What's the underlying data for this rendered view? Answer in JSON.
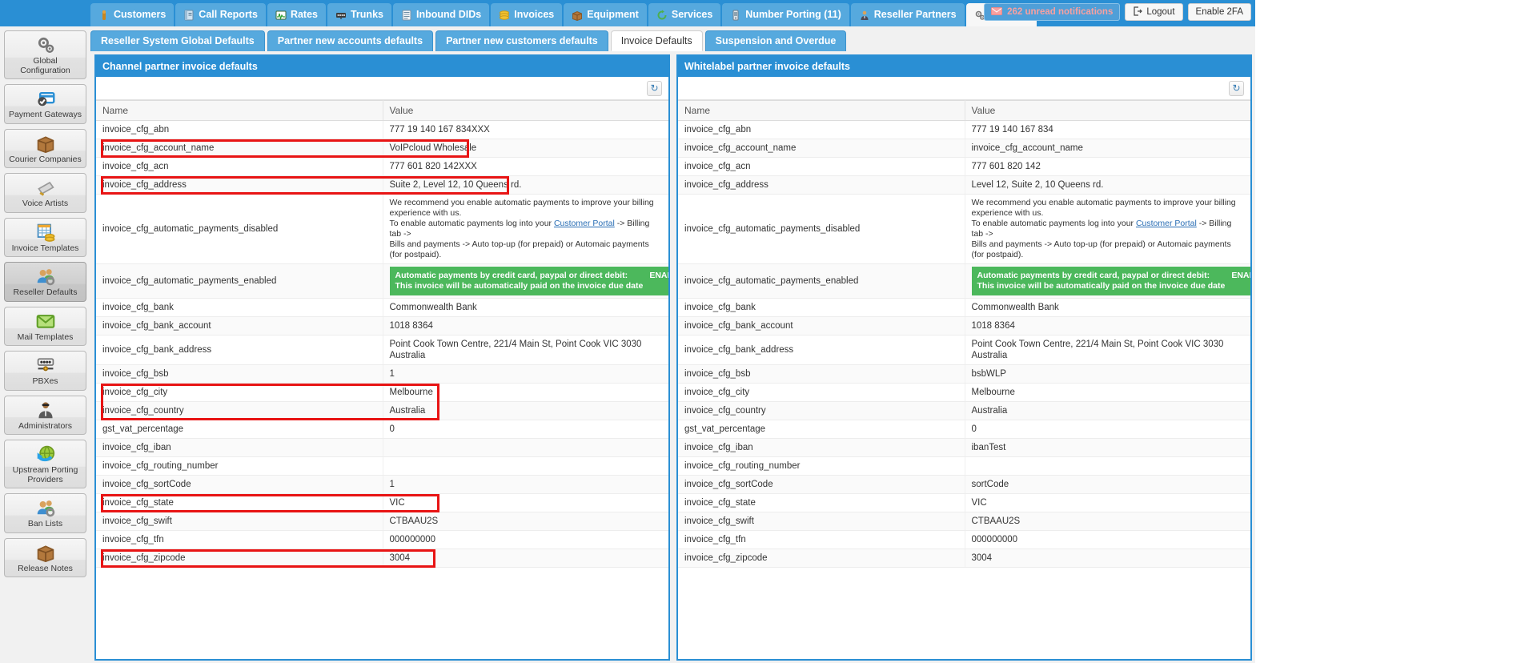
{
  "topnav": {
    "tabs": [
      {
        "label": "Customers",
        "icon": "person-icon"
      },
      {
        "label": "Call Reports",
        "icon": "report-icon"
      },
      {
        "label": "Rates",
        "icon": "chart-icon"
      },
      {
        "label": "Trunks",
        "icon": "trunk-icon"
      },
      {
        "label": "Inbound DIDs",
        "icon": "list-icon"
      },
      {
        "label": "Invoices",
        "icon": "coins-icon"
      },
      {
        "label": "Equipment",
        "icon": "box-icon"
      },
      {
        "label": "Services",
        "icon": "refresh-green-icon"
      },
      {
        "label": "Number Porting (11)",
        "icon": "mobile-icon"
      },
      {
        "label": "Reseller Partners",
        "icon": "suit-person-icon"
      },
      {
        "label": "Settings",
        "icon": "gears-icon",
        "active": true
      }
    ],
    "notifications": "262 unread notifications",
    "logout": "Logout",
    "enable_2fa": "Enable 2FA"
  },
  "subtabs": [
    {
      "label": "Reseller System Global Defaults"
    },
    {
      "label": "Partner new accounts defaults"
    },
    {
      "label": "Partner new customers defaults"
    },
    {
      "label": "Invoice Defaults",
      "active": true
    },
    {
      "label": "Suspension and Overdue"
    }
  ],
  "sidebar": {
    "items": [
      {
        "label": "Global Configuration",
        "icon": "gears-icon"
      },
      {
        "label": "Payment Gateways",
        "icon": "credit-card-icon"
      },
      {
        "label": "Courier Companies",
        "icon": "box-icon"
      },
      {
        "label": "Voice Artists",
        "icon": "megaphone-icon"
      },
      {
        "label": "Invoice Templates",
        "icon": "invoice-icon"
      },
      {
        "label": "Reseller Defaults",
        "icon": "users-gear-icon",
        "active": true
      },
      {
        "label": "Mail Templates",
        "icon": "envelope-icon"
      },
      {
        "label": "PBXes",
        "icon": "pbx-icon"
      },
      {
        "label": "Administrators",
        "icon": "admin-icon"
      },
      {
        "label": "Upstream Porting Providers",
        "icon": "globe-arrow-icon"
      },
      {
        "label": "Ban Lists",
        "icon": "users-gear-icon"
      },
      {
        "label": "Release Notes",
        "icon": "box-icon"
      }
    ]
  },
  "colors": {
    "brand_blue": "#2a8fd4",
    "tab_blue": "#56a9de",
    "green_enabled": "#4cb85c",
    "highlight_red": "#e81414",
    "notification_pink": "#f8a0a0"
  },
  "left_panel": {
    "title": "Channel partner invoice defaults",
    "refresh_icon": "refresh-icon",
    "columns": [
      "Name",
      "Value"
    ],
    "rows": [
      {
        "name": "invoice_cfg_abn",
        "value": "777 19 140 167 834XXX"
      },
      {
        "name": "invoice_cfg_account_name",
        "value": "VoIPcloud Wholesale",
        "highlight": true
      },
      {
        "name": "invoice_cfg_acn",
        "value": "777 601 820 142XXX"
      },
      {
        "name": "invoice_cfg_address",
        "value": "Suite 2, Level 12, 10 Queens rd.",
        "highlight": true
      },
      {
        "name": "invoice_cfg_automatic_payments_disabled",
        "value": "",
        "kind": "rich_disabled"
      },
      {
        "name": "invoice_cfg_automatic_payments_enabled",
        "value": "",
        "kind": "rich_enabled"
      },
      {
        "name": "invoice_cfg_bank",
        "value": "Commonwealth Bank"
      },
      {
        "name": "invoice_cfg_bank_account",
        "value": "1018 8364"
      },
      {
        "name": "invoice_cfg_bank_address",
        "value": "Point Cook Town Centre, 221/4 Main St, Point Cook VIC 3030 Australia"
      },
      {
        "name": "invoice_cfg_bsb",
        "value": "1"
      },
      {
        "name": "invoice_cfg_city",
        "value": "Melbourne",
        "highlight": true
      },
      {
        "name": "invoice_cfg_country",
        "value": "Australia",
        "highlight": true
      },
      {
        "name": "gst_vat_percentage",
        "value": "0"
      },
      {
        "name": "invoice_cfg_iban",
        "value": ""
      },
      {
        "name": "invoice_cfg_routing_number",
        "value": ""
      },
      {
        "name": "invoice_cfg_sortCode",
        "value": "1"
      },
      {
        "name": "invoice_cfg_state",
        "value": "VIC",
        "highlight": true
      },
      {
        "name": "invoice_cfg_swift",
        "value": "CTBAAU2S"
      },
      {
        "name": "invoice_cfg_tfn",
        "value": "000000000"
      },
      {
        "name": "invoice_cfg_zipcode",
        "value": "3004",
        "highlight": true
      }
    ]
  },
  "right_panel": {
    "title": "Whitelabel partner invoice defaults",
    "refresh_icon": "refresh-icon",
    "columns": [
      "Name",
      "Value"
    ],
    "rows": [
      {
        "name": "invoice_cfg_abn",
        "value": "777 19 140 167 834"
      },
      {
        "name": "invoice_cfg_account_name",
        "value": "invoice_cfg_account_name"
      },
      {
        "name": "invoice_cfg_acn",
        "value": "777 601 820 142"
      },
      {
        "name": "invoice_cfg_address",
        "value": "Level 12, Suite 2, 10 Queens rd."
      },
      {
        "name": "invoice_cfg_automatic_payments_disabled",
        "value": "",
        "kind": "rich_disabled"
      },
      {
        "name": "invoice_cfg_automatic_payments_enabled",
        "value": "",
        "kind": "rich_enabled"
      },
      {
        "name": "invoice_cfg_bank",
        "value": "Commonwealth Bank"
      },
      {
        "name": "invoice_cfg_bank_account",
        "value": "1018 8364"
      },
      {
        "name": "invoice_cfg_bank_address",
        "value": "Point Cook Town Centre, 221/4 Main St, Point Cook VIC 3030 Australia"
      },
      {
        "name": "invoice_cfg_bsb",
        "value": "bsbWLP"
      },
      {
        "name": "invoice_cfg_city",
        "value": "Melbourne"
      },
      {
        "name": "invoice_cfg_country",
        "value": "Australia"
      },
      {
        "name": "gst_vat_percentage",
        "value": "0"
      },
      {
        "name": "invoice_cfg_iban",
        "value": "ibanTest"
      },
      {
        "name": "invoice_cfg_routing_number",
        "value": ""
      },
      {
        "name": "invoice_cfg_sortCode",
        "value": "sortCode"
      },
      {
        "name": "invoice_cfg_state",
        "value": "VIC"
      },
      {
        "name": "invoice_cfg_swift",
        "value": "CTBAAU2S"
      },
      {
        "name": "invoice_cfg_tfn",
        "value": "000000000"
      },
      {
        "name": "invoice_cfg_zipcode",
        "value": "3004"
      }
    ]
  },
  "rich_text": {
    "disabled_line1": "We recommend you enable automatic payments to improve your billing experience with us.",
    "disabled_line2_a": "To enable automatic payments log into your ",
    "disabled_link": "Customer Portal",
    "disabled_line2_b": " -> Billing tab ->",
    "disabled_line3": "Bills and payments -> Auto top-up (for prepaid) or Automaic payments (for postpaid).",
    "enabled_line1": "Automatic payments by credit card, paypal or direct debit:",
    "enabled_flag": "ENABLED",
    "enabled_line2": "This invoice will be automatically paid on the invoice due date"
  }
}
